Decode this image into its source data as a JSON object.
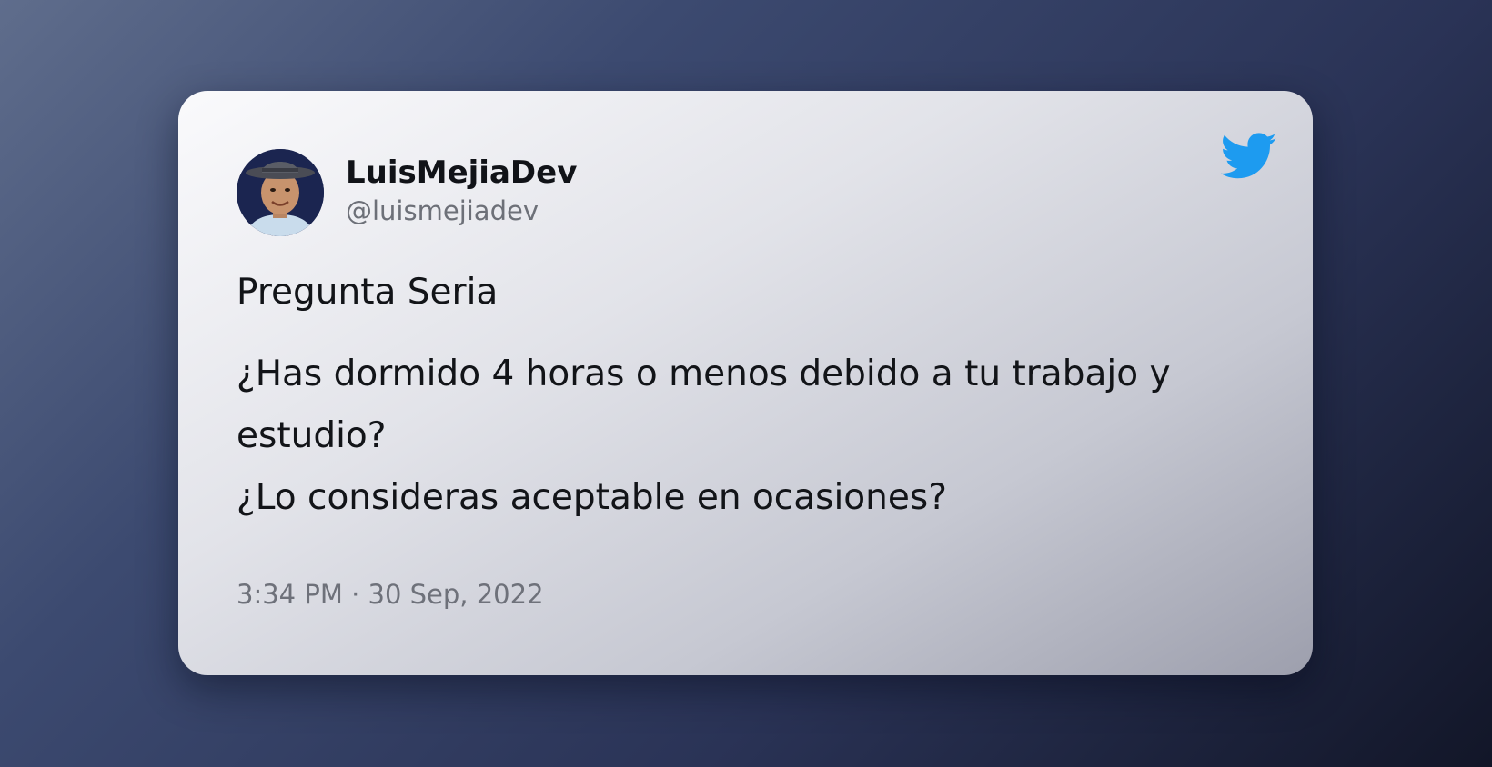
{
  "tweet": {
    "author": {
      "display_name": "LuisMejiaDev",
      "handle": "@luismejiadev",
      "avatar": "profile-photo"
    },
    "title": "Pregunta Seria",
    "question_1": "¿Has dormido 4 horas o menos debido a tu trabajo y estudio?",
    "question_2": "¿Lo consideras aceptable en ocasiones?",
    "timestamp": "3:34 PM · 30 Sep, 2022",
    "platform_icon": "twitter-bird-icon",
    "icon_color": "#1d9bf0"
  }
}
